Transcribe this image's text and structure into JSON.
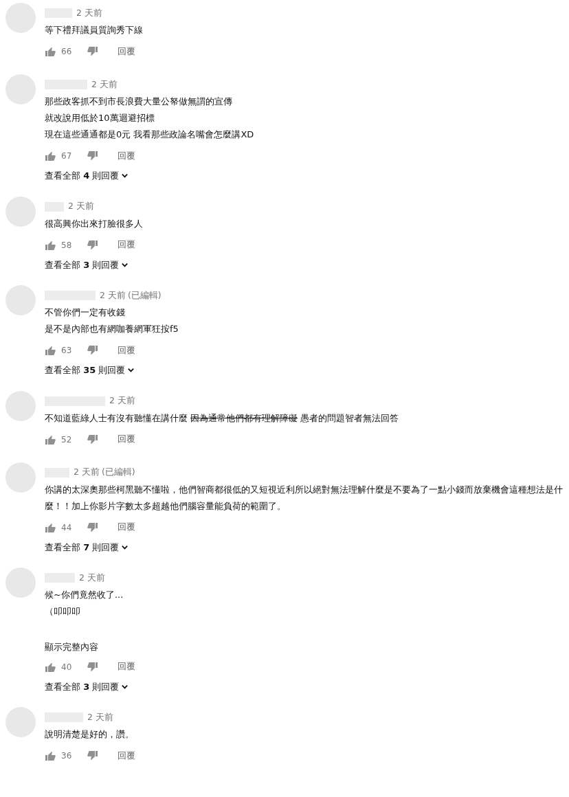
{
  "comments": [
    {
      "time": "2 天前",
      "lines": [
        [
          {
            "text": "等下禮拜議員質詢秀下線",
            "struck": false
          }
        ]
      ],
      "likes": "66",
      "reply": "回覆"
    },
    {
      "time": "2 天前",
      "lines": [
        [
          {
            "text": "那些政客抓不到市長浪費大量公帑做無謂的宣傳",
            "struck": false
          }
        ],
        [
          {
            "text": "就改說用低於10萬迴避招標",
            "struck": false
          }
        ],
        [
          {
            "text": "現在這些通通都是0元 我看那些政論名嘴會怎麼講XD",
            "struck": false
          }
        ]
      ],
      "likes": "67",
      "reply": "回覆",
      "replies": "查看全部 **4** 則回覆"
    },
    {
      "time": "2 天前",
      "lines": [
        [
          {
            "text": "很高興你出來打臉很多人",
            "struck": false
          }
        ]
      ],
      "likes": "58",
      "reply": "回覆",
      "replies": "查看全部 **3** 則回覆"
    },
    {
      "time": "2 天前",
      "edited": "(已編輯)",
      "lines": [
        [
          {
            "text": "不管你們一定有收錢",
            "struck": false
          }
        ],
        [
          {
            "text": "是不是內部也有網咖養網軍狂按f5",
            "struck": false
          }
        ]
      ],
      "likes": "63",
      "reply": "回覆",
      "replies": "查看全部 **35** 則回覆"
    },
    {
      "time": "2 天前",
      "lines": [
        [
          {
            "text": "不知道藍綠人士有沒有聽懂在講什麼 ",
            "struck": false
          },
          {
            "text": "因為通常他們都有理解障礙",
            "struck": true
          },
          {
            "text": " 愚者的問題智者無法回答",
            "struck": false
          }
        ]
      ],
      "likes": "52",
      "reply": "回覆"
    },
    {
      "time": "2 天前",
      "edited": "(已編輯)",
      "lines": [
        [
          {
            "text": "你講的太深奧那些柯黑聽不懂啦，他們智商都很低的又短視近利所以絕對無法理解什麼是不要為了一點小錢而放棄機會這種想法是什麼！！加上你影片字數太多超越他們腦容量能負荷的範圍了。",
            "struck": false
          }
        ]
      ],
      "likes": "44",
      "reply": "回覆",
      "replies": "查看全部 **7** 則回覆"
    },
    {
      "time": "2 天前",
      "lines": [
        [
          {
            "text": "候~你們竟然收了...",
            "struck": false
          }
        ],
        [
          {
            "text": "（叩叩叩",
            "struck": false
          }
        ]
      ],
      "show_more": "顯示完整內容",
      "likes": "40",
      "reply": "回覆",
      "replies": "查看全部 **3** 則回覆"
    },
    {
      "time": "2 天前",
      "lines": [
        [
          {
            "text": "說明清楚是好的，讚。",
            "struck": false
          }
        ]
      ],
      "likes": "36",
      "reply": "回覆"
    }
  ]
}
